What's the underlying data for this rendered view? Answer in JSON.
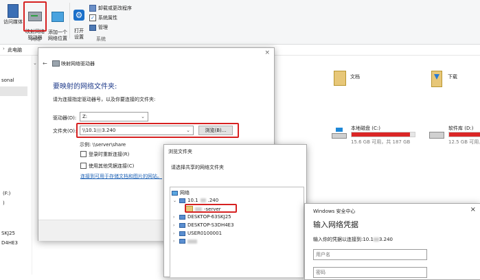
{
  "ribbon": {
    "access_media": "访问媒体",
    "map_drive": "映射网络\n驱动器",
    "add_location": "添加一个\n网络位置",
    "open_settings": "打开\n设置",
    "uninstall": "卸载或更改程序",
    "system_props": "系统属性",
    "manage": "管理",
    "group_network": "网络",
    "group_system": "系统"
  },
  "address": {
    "path": "此电脑"
  },
  "explorer": {
    "left_items": [
      "sonal",
      "(F:)",
      ")",
      "SKJ25",
      "D4HE3"
    ],
    "folders": [
      {
        "name": "文档"
      },
      {
        "name": "下载"
      }
    ],
    "drives": [
      {
        "name": "本地磁盘 (C:)",
        "free": "15.6 GB 可用，共 187 GB",
        "used_pct": 92
      },
      {
        "name": "软件库 (D:)",
        "free": "12.5 GB 可用，共",
        "used_pct": 95
      }
    ]
  },
  "map_dialog": {
    "title": "映射网络驱动器",
    "heading": "要映射的网络文件夹:",
    "instruction": "请为连接指定驱动器号，以及你要连接的文件夹:",
    "drive_label": "驱动器(D):",
    "drive_value": "Z:",
    "folder_label": "文件夹(O):",
    "folder_value_prefix": "\\\\10.1",
    "folder_value_suffix": "3.240",
    "browse_button": "浏览(B)...",
    "example": "示例: \\\\server\\share",
    "reconnect_label": "登录时重新连接(R)",
    "other_creds_label": "使用其他凭据连接(C)",
    "link": "连接到可用于存储文档和图片的网站。"
  },
  "browse_dialog": {
    "title": "浏览文件夹",
    "instruction": "请选择共享的网络文件夹",
    "tree": {
      "root": "网络",
      "host_prefix": "10.1",
      "host_suffix": ".240",
      "share_suffix": "-server",
      "computers": [
        "DESKTOP-63SKJ25",
        "DESKTOP-S3DH4E3",
        "USER0100001"
      ]
    }
  },
  "security_dialog": {
    "title": "Windows 安全中心",
    "heading": "输入网络凭据",
    "instruction_prefix": "输入你的凭据以连接到:10.1",
    "instruction_suffix": "3.240",
    "username_placeholder": "用户名",
    "password_placeholder": "密码"
  }
}
